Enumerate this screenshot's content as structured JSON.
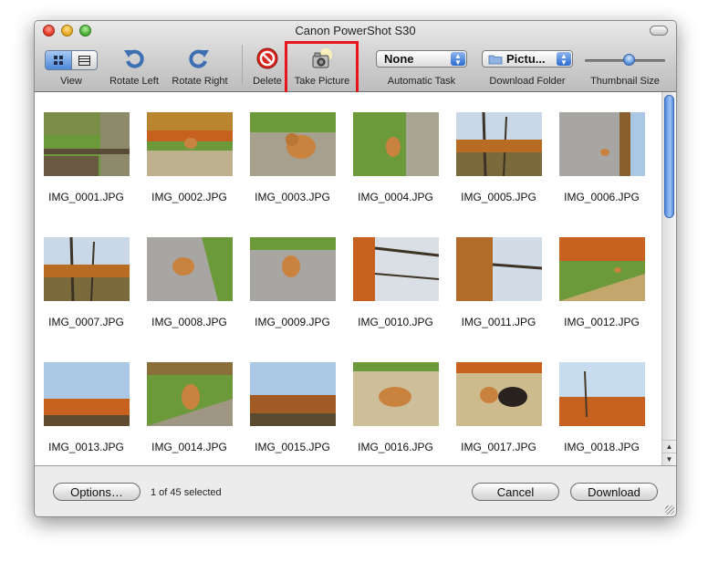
{
  "window": {
    "title": "Canon PowerShot S30"
  },
  "toolbar": {
    "view_label": "View",
    "rotate_left_label": "Rotate Left",
    "rotate_right_label": "Rotate Right",
    "delete_label": "Delete",
    "take_picture_label": "Take Picture",
    "automatic_task": {
      "label": "Automatic Task",
      "value": "None"
    },
    "download_folder": {
      "label": "Download Folder",
      "value": "Pictu..."
    },
    "thumbnail_size": {
      "label": "Thumbnail Size",
      "value": 0.55
    }
  },
  "photos": [
    {
      "name": "IMG_0001.JPG",
      "scene": "grass",
      "selected": false
    },
    {
      "name": "IMG_0002.JPG",
      "scene": "dogpath",
      "selected": false
    },
    {
      "name": "IMG_0003.JPG",
      "scene": "dogbig",
      "selected": false
    },
    {
      "name": "IMG_0004.JPG",
      "scene": "dogside",
      "selected": false
    },
    {
      "name": "IMG_0005.JPG",
      "scene": "trees",
      "selected": false
    },
    {
      "name": "IMG_0006.JPG",
      "scene": "roadside",
      "selected": false
    },
    {
      "name": "IMG_0007.JPG",
      "scene": "trees",
      "selected": false
    },
    {
      "name": "IMG_0008.JPG",
      "scene": "dogtilt",
      "selected": false
    },
    {
      "name": "IMG_0009.JPG",
      "scene": "dogroad",
      "selected": false
    },
    {
      "name": "IMG_0010.JPG",
      "scene": "treeside",
      "selected": false
    },
    {
      "name": "IMG_0011.JPG",
      "scene": "treeside2",
      "selected": false
    },
    {
      "name": "IMG_0012.JPG",
      "scene": "field",
      "selected": false
    },
    {
      "name": "IMG_0013.JPG",
      "scene": "sky",
      "selected": false
    },
    {
      "name": "IMG_0014.JPG",
      "scene": "dogfield",
      "selected": false
    },
    {
      "name": "IMG_0015.JPG",
      "scene": "sky2",
      "selected": false
    },
    {
      "name": "IMG_0016.JPG",
      "scene": "doglie",
      "selected": false
    },
    {
      "name": "IMG_0017.JPG",
      "scene": "twodogs",
      "selected": false
    },
    {
      "name": "IMG_0018.JPG",
      "scene": "sky3",
      "selected": false
    }
  ],
  "footer": {
    "options_label": "Options…",
    "status": "1 of 45 selected",
    "cancel_label": "Cancel",
    "download_label": "Download"
  },
  "colors": {
    "highlight": "#e8151a",
    "dog": "#c9833f",
    "dark_dog": "#2a221e",
    "autumn": "#c6611f",
    "grass": "#6c9a3a",
    "sky": "#aac8e6",
    "road": "#a8a6a2"
  }
}
